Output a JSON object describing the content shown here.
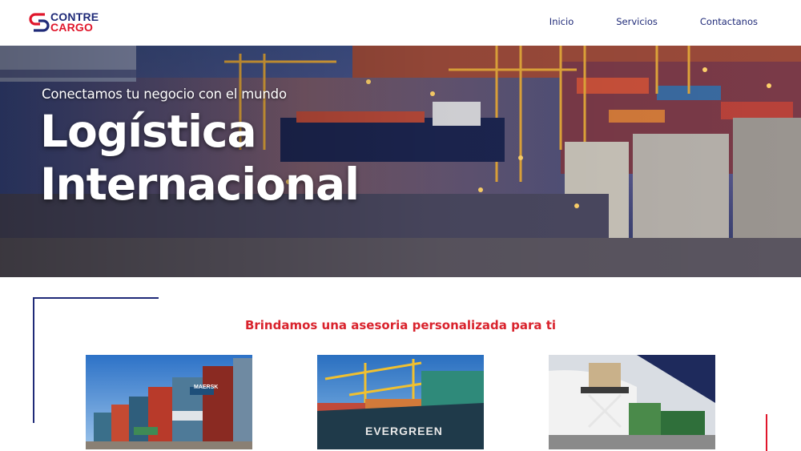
{
  "header": {
    "logo": {
      "line1": "CONTRE",
      "line2": "CARGO"
    },
    "nav": [
      {
        "label": "Inicio"
      },
      {
        "label": "Servicios"
      },
      {
        "label": "Contactanos"
      }
    ]
  },
  "hero": {
    "subtitle": "Conectamos tu negocio con el mundo",
    "title_line1": "Logística",
    "title_line2": "Internacional"
  },
  "services": {
    "title": "Brindamos una asesoria personalizada para ti",
    "cards": [
      {
        "image": "container-yard-photo",
        "text": "MAERSK"
      },
      {
        "image": "container-ship-photo",
        "text": "EVERGREEN"
      },
      {
        "image": "air-cargo-photo"
      }
    ]
  },
  "colors": {
    "brand_navy": "#1f2a78",
    "brand_red": "#e0162b",
    "section_title_red": "#d9232d"
  }
}
